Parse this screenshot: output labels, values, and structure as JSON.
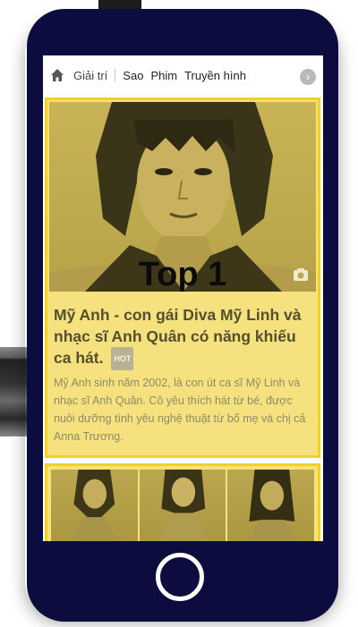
{
  "nav": {
    "items": [
      "Giải trí",
      "Sao",
      "Phim",
      "Truyền hình"
    ]
  },
  "article": {
    "rank": "Top 1",
    "title": "Mỹ Anh - con gái Diva Mỹ Linh và nhạc sĩ Anh Quân có năng khiếu ca hát.",
    "badge": "HOT",
    "summary": "Mỹ Anh sinh năm 2002, là con út ca sĩ Mỹ Linh và nhạc sĩ Anh Quân. Cô yêu thích hát từ bé, được nuôi dưỡng tình yêu nghệ thuật từ bố mẹ và chị cả Anna Trương."
  },
  "colors": {
    "phone": "#0d0c3f",
    "card_bg": "#f5e27f",
    "card_border": "#f2d21f"
  },
  "icons": [
    "home-icon",
    "chevron-right-icon",
    "camera-icon",
    "home-button"
  ]
}
